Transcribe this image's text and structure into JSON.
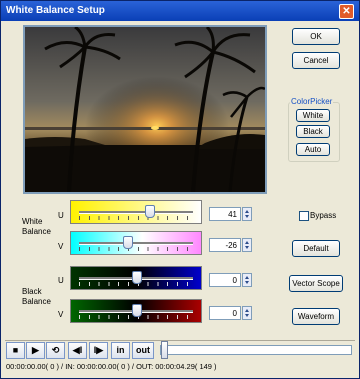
{
  "window": {
    "title": "White Balance Setup",
    "close_glyph": "✕"
  },
  "buttons": {
    "ok": "OK",
    "cancel": "Cancel",
    "default": "Default",
    "vector_scope": "Vector Scope",
    "waveform": "Waveform"
  },
  "colorpicker": {
    "label": "ColorPicker",
    "white": "White",
    "black": "Black",
    "auto": "Auto"
  },
  "white_balance": {
    "label": "White Balance",
    "u_label": "U",
    "v_label": "V",
    "u_value": "41",
    "v_value": "-26",
    "u_level": 0.61,
    "v_level": 0.42
  },
  "black_balance": {
    "label": "Black Balance",
    "u_label": "U",
    "v_label": "V",
    "u_value": "0",
    "v_value": "0",
    "u_level": 0.5,
    "v_level": 0.5
  },
  "bypass": {
    "label": "Bypass",
    "checked": false
  },
  "transport": {
    "stop": "■",
    "play": "▶",
    "loop": "⟲",
    "prev": "◀I",
    "next": "I▶",
    "in": "in",
    "out": "out"
  },
  "status": "00:00:00.00( 0 ) / IN: 00:00:00.00( 0 ) / OUT: 00:00:04.29( 149 )",
  "colors": {
    "title_bar": "#0a3fb6",
    "u_white_gradient": [
      "#fff200",
      "#ffffff"
    ],
    "v_white_gradient": [
      "#00ffff",
      "#ff88ff"
    ],
    "u_black_gradient": [
      "#003300",
      "#0000cc"
    ],
    "v_black_gradient": [
      "#006600",
      "#aa0000"
    ]
  }
}
